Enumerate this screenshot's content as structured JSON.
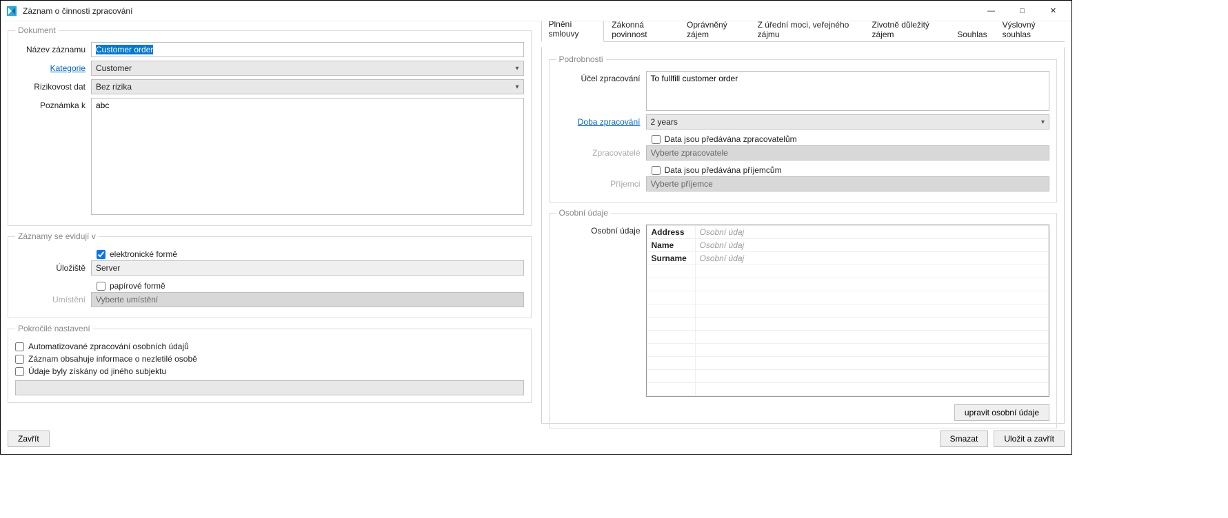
{
  "window": {
    "title": "Záznam o činnosti zpracování"
  },
  "document": {
    "legend": "Dokument",
    "name_label": "Název záznamu",
    "name_value": "Customer order",
    "category_label": "Kategorie",
    "category_value": "Customer",
    "risk_label": "Rizikovost dat",
    "risk_value": "Bez rizika",
    "note_label": "Poznámka k",
    "note_value": "abc"
  },
  "records": {
    "legend": "Záznamy se evidují v",
    "electronic_label": "elektronické formě",
    "electronic_checked": true,
    "storage_label": "Úložiště",
    "storage_value": "Server",
    "paper_label": "papírové formě",
    "paper_checked": false,
    "location_label": "Umístění",
    "location_placeholder": "Vyberte umístění"
  },
  "advanced": {
    "legend": "Pokročilé nastavení",
    "auto_label": "Automatizované zpracování osobních údajů",
    "minor_label": "Záznam obsahuje informace o nezletilé osobě",
    "other_subject_label": "Údaje byly získány od jiného subjektu"
  },
  "tabs": [
    {
      "label": "Plnění smlouvy",
      "active": true
    },
    {
      "label": "Zákonná povinnost",
      "active": false
    },
    {
      "label": "Oprávněný zájem",
      "active": false
    },
    {
      "label": "Z úřední moci, veřejného zájmu",
      "active": false
    },
    {
      "label": "Životně důležitý zájem",
      "active": false
    },
    {
      "label": "Souhlas",
      "active": false
    },
    {
      "label": "Výslovný souhlas",
      "active": false
    }
  ],
  "details": {
    "legend": "Podrobnosti",
    "purpose_label": "Účel zpracování",
    "purpose_value": "To fullfill customer order",
    "duration_label": "Doba zpracování",
    "duration_value": "2 years",
    "processors_check_label": "Data jsou předávána zpracovatelům",
    "processors_label": "Zpracovatelé",
    "processors_placeholder": "Vyberte zpracovatele",
    "recipients_check_label": "Data jsou předávána příjemcům",
    "recipients_label": "Příjemci",
    "recipients_placeholder": "Vyberte příjemce"
  },
  "personal": {
    "legend": "Osobní údaje",
    "label": "Osobní údaje",
    "placeholder": "Osobní údaj",
    "rows": [
      "Address",
      "Name",
      "Surname"
    ],
    "edit_button": "upravit osobní údaje"
  },
  "footer": {
    "close": "Zavřít",
    "delete": "Smazat",
    "save_close": "Uložit a zavřít"
  }
}
